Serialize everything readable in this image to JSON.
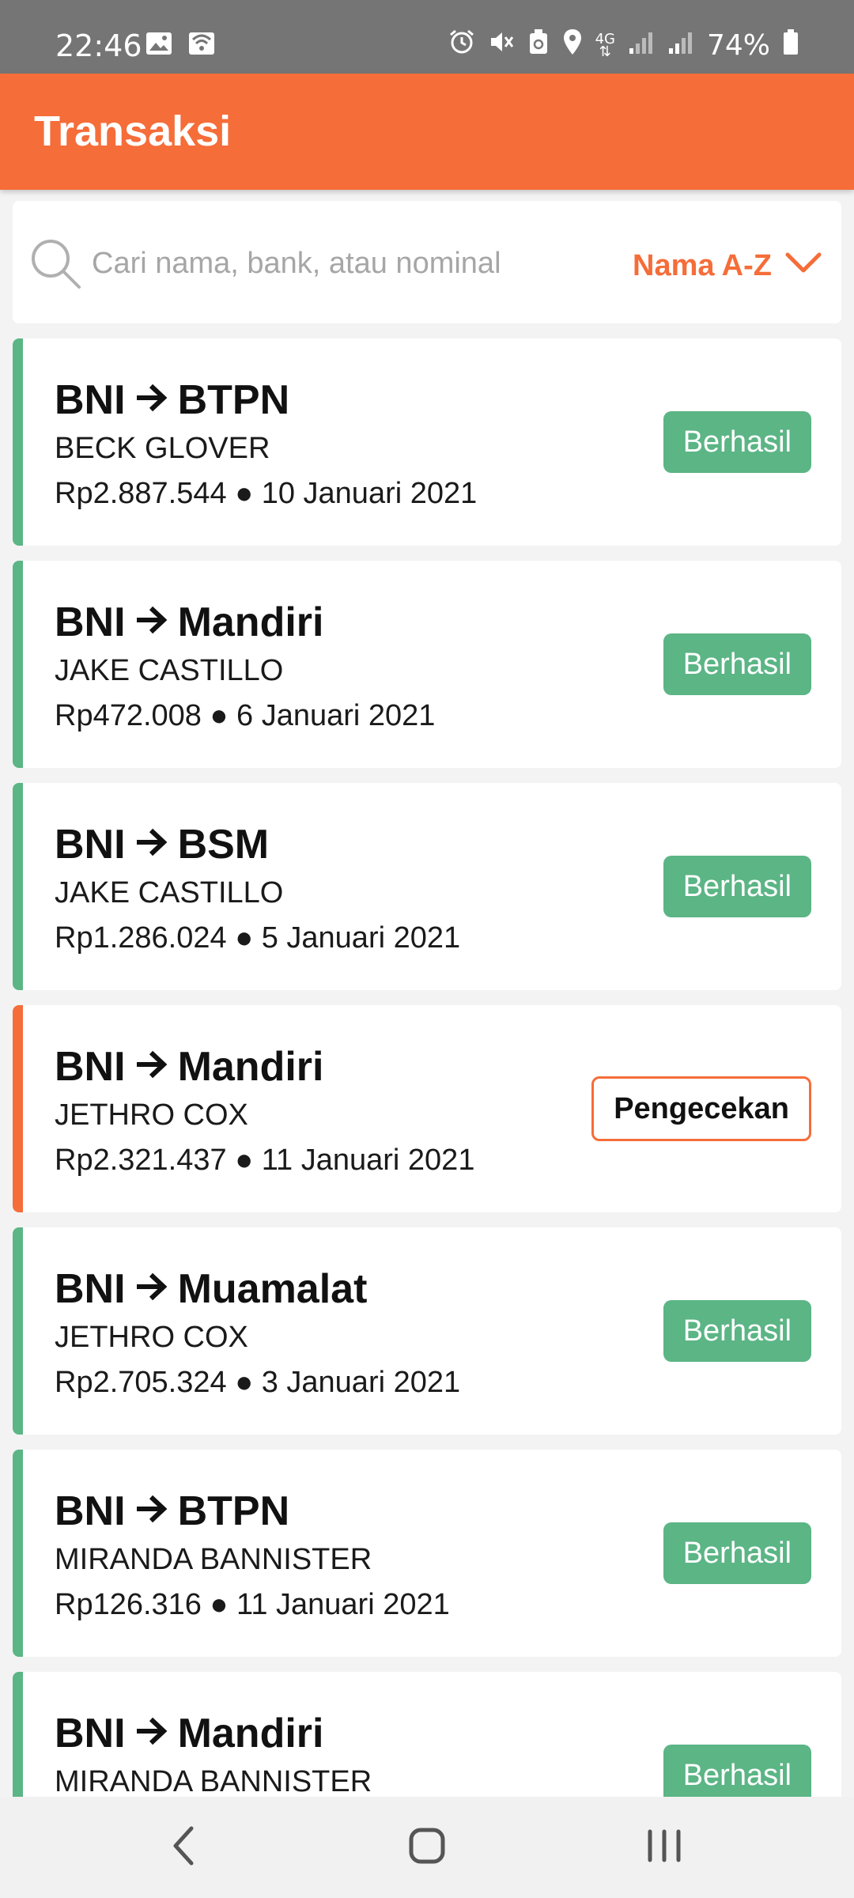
{
  "status_bar": {
    "time": "22:46",
    "battery": "74%",
    "network": "4G",
    "icons": [
      "image-icon",
      "cast-icon",
      "alarm-icon",
      "mute-icon",
      "recycle-icon",
      "location-icon",
      "signal-icon",
      "battery-icon"
    ]
  },
  "app_bar": {
    "title": "Transaksi"
  },
  "search": {
    "placeholder": "Cari nama, bank, atau nominal",
    "value": "",
    "sort_label": "Nama A-Z"
  },
  "colors": {
    "primary": "#f56d39",
    "success": "#5bb585",
    "background": "#f3f3f3"
  },
  "transactions": [
    {
      "from": "BNI",
      "to": "BTPN",
      "name": "BECK GLOVER",
      "amount": "Rp2.887.544",
      "date": "10 Januari 2021",
      "status": "Berhasil"
    },
    {
      "from": "BNI",
      "to": "Mandiri",
      "name": "JAKE CASTILLO",
      "amount": "Rp472.008",
      "date": "6 Januari 2021",
      "status": "Berhasil"
    },
    {
      "from": "BNI",
      "to": "BSM",
      "name": "JAKE CASTILLO",
      "amount": "Rp1.286.024",
      "date": "5 Januari 2021",
      "status": "Berhasil"
    },
    {
      "from": "BNI",
      "to": "Mandiri",
      "name": "JETHRO COX",
      "amount": "Rp2.321.437",
      "date": "11 Januari 2021",
      "status": "Pengecekan"
    },
    {
      "from": "BNI",
      "to": "Muamalat",
      "name": "JETHRO COX",
      "amount": "Rp2.705.324",
      "date": "3 Januari 2021",
      "status": "Berhasil"
    },
    {
      "from": "BNI",
      "to": "BTPN",
      "name": "MIRANDA BANNISTER",
      "amount": "Rp126.316",
      "date": "11 Januari 2021",
      "status": "Berhasil"
    },
    {
      "from": "BNI",
      "to": "Mandiri",
      "name": "MIRANDA BANNISTER",
      "amount": "",
      "date": "",
      "status": "Berhasil"
    }
  ],
  "nav_bar": {
    "buttons": [
      "back-icon",
      "home-icon",
      "recents-icon"
    ]
  }
}
